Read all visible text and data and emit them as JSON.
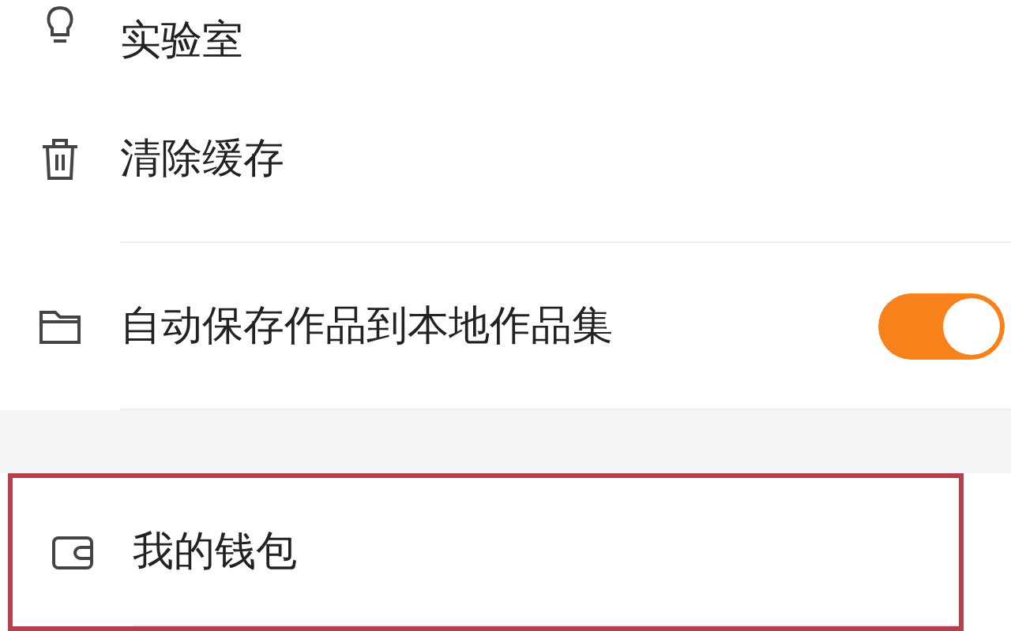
{
  "sections": [
    {
      "items": [
        {
          "kind": "link",
          "label": "实验室",
          "highlighted": false
        },
        {
          "kind": "link",
          "label": "清除缓存",
          "highlighted": false
        },
        {
          "kind": "toggle",
          "label": "自动保存作品到本地作品集",
          "on": true,
          "highlighted": false
        }
      ]
    },
    {
      "items": [
        {
          "kind": "link",
          "label": "我的钱包",
          "highlighted": true
        }
      ]
    }
  ]
}
